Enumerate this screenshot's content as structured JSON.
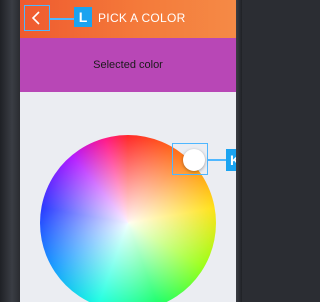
{
  "header": {
    "title": "PICK A COLOR",
    "back_icon": "chevron-left-icon",
    "callout_label": "L"
  },
  "selected": {
    "label": "Selected color",
    "color": "#b847b6"
  },
  "picker": {
    "callout_label": "K",
    "handle_color": "#ffffff"
  },
  "colors": {
    "appbar_start": "#ef5a2f",
    "appbar_end": "#f58a46",
    "callout": "#1aa3f0",
    "screen_bg": "#ebedf2"
  }
}
